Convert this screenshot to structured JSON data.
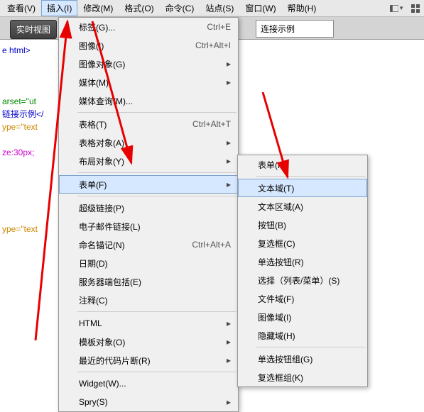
{
  "menubar": {
    "items": [
      "查看(V)",
      "插入(I)",
      "修改(M)",
      "格式(O)",
      "命令(C)",
      "站点(S)",
      "窗口(W)",
      "帮助(H)"
    ]
  },
  "toolbar": {
    "realtime_btn": "实时视图",
    "title_value": "连接示例"
  },
  "code_fragments": {
    "l1": "e html>",
    "l2": "arset=\"ut",
    "l3": "链接示例</",
    "l4": "ype=\"text",
    "l5": "ze:30px;",
    "l6": "ype=\"text"
  },
  "menu": {
    "tag_g": "标签(G)...",
    "tag_g_key": "Ctrl+E",
    "image": "图像(I)",
    "image_key": "Ctrl+Alt+I",
    "image_obj": "图像对象(G)",
    "media": "媒体(M)",
    "media_query": "媒体查询(M)...",
    "table": "表格(T)",
    "table_key": "Ctrl+Alt+T",
    "table_obj": "表格对象(A)",
    "layout_obj": "布局对象(Y)",
    "form": "表单(F)",
    "hyperlink": "超级链接(P)",
    "email_link": "电子邮件链接(L)",
    "anchor": "命名锚记(N)",
    "anchor_key": "Ctrl+Alt+A",
    "date": "日期(D)",
    "ssi": "服务器端包括(E)",
    "comment": "注释(C)",
    "html": "HTML",
    "tmpl_obj": "模板对象(O)",
    "recent_snip": "最近的代码片断(R)",
    "widget": "Widget(W)...",
    "spry": "Spry(S)"
  },
  "submenu": {
    "form": "表单(F)",
    "text_field": "文本域(T)",
    "textarea": "文本区域(A)",
    "button": "按钮(B)",
    "checkbox": "复选框(C)",
    "radio": "单选按钮(R)",
    "select": "选择（列表/菜单）(S)",
    "file_field": "文件域(F)",
    "image_field": "图像域(I)",
    "hidden": "隐藏域(H)",
    "radio_group": "单选按钮组(G)",
    "checkbox_group": "复选框组(K)"
  }
}
